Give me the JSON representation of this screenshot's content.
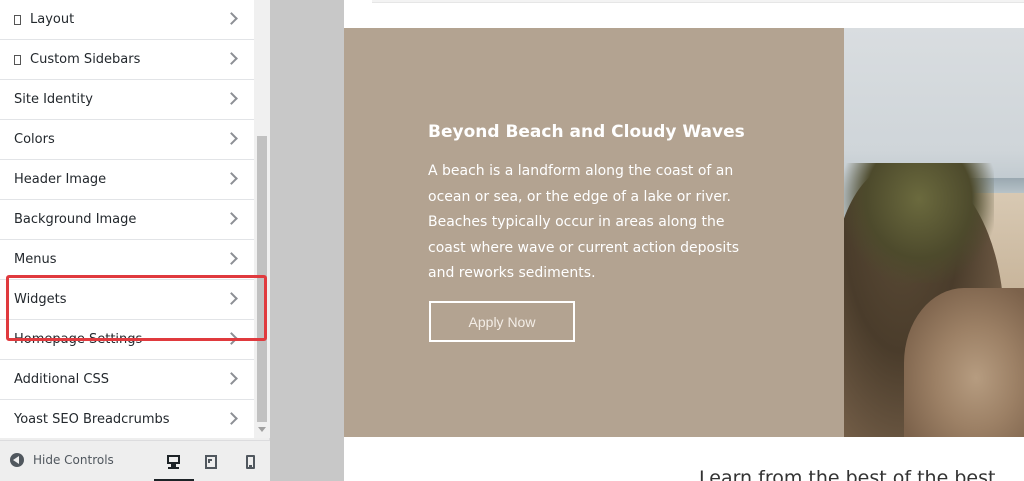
{
  "sidebar": {
    "items": [
      {
        "label": "Layout",
        "has_icon": true
      },
      {
        "label": "Custom Sidebars",
        "has_icon": true
      },
      {
        "label": "Site Identity",
        "has_icon": false
      },
      {
        "label": "Colors",
        "has_icon": false
      },
      {
        "label": "Header Image",
        "has_icon": false
      },
      {
        "label": "Background Image",
        "has_icon": false
      },
      {
        "label": "Menus",
        "has_icon": false
      },
      {
        "label": "Widgets",
        "has_icon": false,
        "highlighted": true
      },
      {
        "label": "Homepage Settings",
        "has_icon": false
      },
      {
        "label": "Additional CSS",
        "has_icon": false
      },
      {
        "label": "Yoast SEO Breadcrumbs",
        "has_icon": false
      }
    ],
    "icons": {
      "item": "square-icon",
      "chevron": "chevron-right-icon"
    }
  },
  "footer": {
    "hide_controls_label": "Hide Controls",
    "hide_icon": "arrow-left-circle-icon",
    "devices": [
      {
        "name": "desktop",
        "icon": "desktop-icon",
        "active": true
      },
      {
        "name": "tablet",
        "icon": "tablet-icon",
        "active": false
      },
      {
        "name": "mobile",
        "icon": "mobile-icon",
        "active": false
      }
    ]
  },
  "preview": {
    "hero": {
      "title": "Beyond Beach and Cloudy Waves",
      "body": "A beach is a landform along the coast of an ocean or sea, or the edge of a lake or river. Beaches typically occur in areas along the coast where wave or current action deposits and reworks sediments.",
      "button_label": "Apply Now",
      "background_color": "#b3a391"
    },
    "section_heading": "Learn from the best of the best"
  },
  "colors": {
    "highlight": "#e03a3e"
  }
}
